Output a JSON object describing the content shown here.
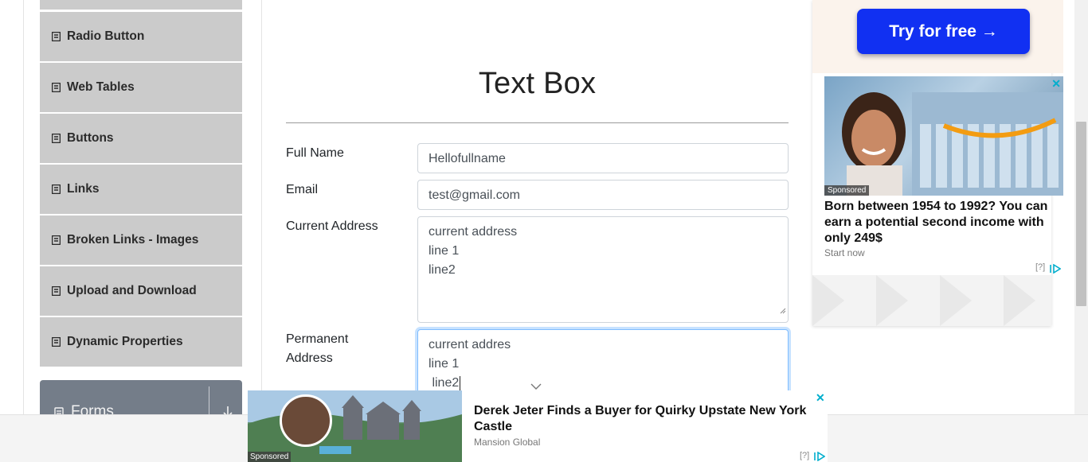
{
  "sidebar": {
    "items": [
      {
        "label": "Radio Button",
        "icon": "book-icon"
      },
      {
        "label": "Web Tables",
        "icon": "book-icon"
      },
      {
        "label": "Buttons",
        "icon": "book-icon"
      },
      {
        "label": "Links",
        "icon": "book-icon"
      },
      {
        "label": "Broken Links - Images",
        "icon": "book-icon"
      },
      {
        "label": "Upload and Download",
        "icon": "book-icon"
      },
      {
        "label": "Dynamic Properties",
        "icon": "book-icon"
      }
    ],
    "group": {
      "label": "Forms",
      "icon": "doc-icon",
      "toggle_icon": "arrow-down-icon"
    }
  },
  "main": {
    "title": "Text Box",
    "form": {
      "full_name": {
        "label": "Full Name",
        "value": "Hellofullname"
      },
      "email": {
        "label": "Email",
        "value": "test@gmail.com"
      },
      "current_address": {
        "label": "Current Address",
        "lines": [
          "current address",
          "line 1",
          "line2"
        ]
      },
      "permanent_address": {
        "label_line1": "Permanent",
        "label_line2": "Address",
        "lines": [
          "current addres",
          "line 1",
          " line2"
        ]
      }
    }
  },
  "ad_right": {
    "button": "Try for free →",
    "sponsored": "Sponsored",
    "headline": "Born between 1954 to 1992? You can earn a potential second income with only 249$",
    "source": "Start now",
    "info": "[?]"
  },
  "ad_bottom": {
    "sponsored": "Sponsored",
    "title": "Derek Jeter Finds a Buyer for Quirky Upstate New York Castle",
    "source": "Mansion Global",
    "info": "[?]"
  },
  "colors": {
    "menu_bg": "#cbcbcb",
    "group_bg": "#747d89",
    "ad_button": "#1130f2",
    "focus_border": "#80bdff",
    "ad_accent": "#00aecd"
  }
}
